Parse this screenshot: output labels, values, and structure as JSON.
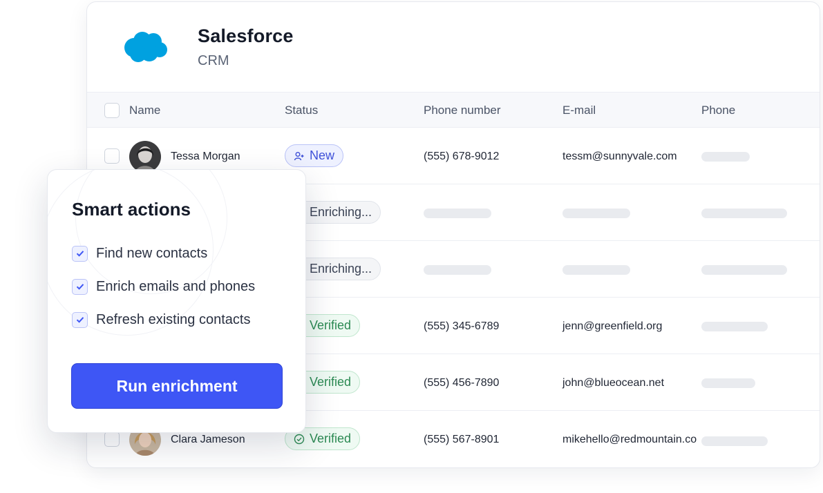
{
  "crm": {
    "title": "Salesforce",
    "subtitle": "CRM",
    "logo_icon": "salesforce-cloud-icon",
    "brand_color": "#00A1E0"
  },
  "table": {
    "columns": [
      "Name",
      "Status",
      "Phone number",
      "E-mail",
      "Phone"
    ],
    "rows": [
      {
        "name": "Tessa Morgan",
        "status": "New",
        "status_icon": "user-add-icon",
        "phone": "(555) 678-9012",
        "email": "tessm@sunnyvale.com"
      },
      {
        "name": "",
        "status": "Enriching...",
        "status_icon": "spinner-icon",
        "phone": "",
        "email": ""
      },
      {
        "name": "",
        "status": "Enriching...",
        "status_icon": "spinner-icon",
        "phone": "",
        "email": ""
      },
      {
        "name": "",
        "status": "Verified",
        "status_icon": "check-circle-icon",
        "phone": "(555) 345-6789",
        "email": "jenn@greenfield.org"
      },
      {
        "name": "",
        "status": "Verified",
        "status_icon": "check-circle-icon",
        "phone": "(555) 456-7890",
        "email": "john@blueocean.net"
      },
      {
        "name": "Clara Jameson",
        "status": "Verified",
        "status_icon": "check-circle-icon",
        "phone": "(555) 567-8901",
        "email": "mikehello@redmountain.co"
      }
    ]
  },
  "smart_actions": {
    "title": "Smart actions",
    "items": [
      {
        "label": "Find new contacts",
        "checked": true
      },
      {
        "label": "Enrich emails and phones",
        "checked": true
      },
      {
        "label": "Refresh existing contacts",
        "checked": true
      }
    ],
    "run_label": "Run enrichment"
  },
  "colors": {
    "accent": "#3E56F5",
    "new": "#3F51D8",
    "verified": "#2C8A53"
  }
}
